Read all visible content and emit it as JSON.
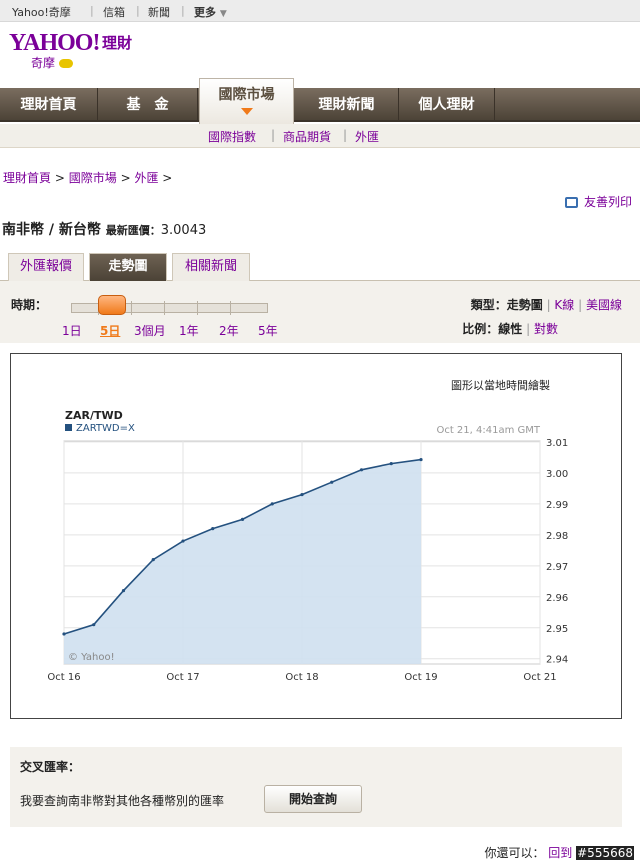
{
  "topbar": {
    "brand": "Yahoo!奇摩",
    "mail": "信箱",
    "news": "新聞",
    "more": "更多"
  },
  "logo": {
    "main": "YAHOO!",
    "sub": "奇摩",
    "section": "理財"
  },
  "nav": {
    "items": [
      "理財首頁",
      "基　金",
      "國際市場",
      "理財新聞",
      "個人理財"
    ]
  },
  "subnav": {
    "items": [
      "國際指數",
      "商品期貨",
      "外匯"
    ]
  },
  "breadcrumb": {
    "items": [
      "理財首頁",
      "國際市場",
      "外匯"
    ]
  },
  "print": {
    "label": "友善列印"
  },
  "page": {
    "title": "南非幣 / 新台幣",
    "rate_label": "最新匯價：",
    "rate_value": "3.0043"
  },
  "tabs": [
    "外匯報價",
    "走勢圖",
    "相關新聞"
  ],
  "controls": {
    "period_label": "時期：",
    "periods": [
      "1日",
      "5日",
      "3個月",
      "1年",
      "2年",
      "5年"
    ],
    "selected_period": "5日",
    "type_label": "類型：",
    "types": [
      "走勢圖",
      "K線",
      "美國線"
    ],
    "scale_label": "比例：",
    "scales": [
      "線性",
      "對數"
    ]
  },
  "chart_note": "圖形以當地時間繪製",
  "chart_data": {
    "type": "area",
    "title": "ZAR/TWD",
    "legend": "ZARTWD=X",
    "timestamp": "Oct 21, 4:41am GMT",
    "watermark": "© Yahoo!",
    "x_ticks": [
      "Oct 16",
      "Oct 17",
      "Oct 18",
      "Oct 19",
      "Oct 21"
    ],
    "y_ticks": [
      "3.01",
      "3.00",
      "2.99",
      "2.98",
      "2.97",
      "2.96",
      "2.95",
      "2.94"
    ],
    "ylim": [
      2.9383,
      3.0103
    ],
    "x": [
      0,
      0.25,
      0.5,
      0.75,
      1,
      1.25,
      1.5,
      1.75,
      2,
      2.25,
      2.5,
      2.75,
      3
    ],
    "values": [
      2.948,
      2.951,
      2.962,
      2.972,
      2.978,
      2.982,
      2.985,
      2.99,
      2.993,
      2.997,
      3.001,
      3.003,
      3.0043
    ],
    "color": "#24517f",
    "fill": "#cfe0ef"
  },
  "cross": {
    "title": "交叉匯率：",
    "text": "我要查詢南非幣對其他各種幣別的匯率",
    "button": "開始查詢"
  },
  "footer": {
    "label": "你還可以：",
    "link": "回到",
    "code": "#555668"
  }
}
